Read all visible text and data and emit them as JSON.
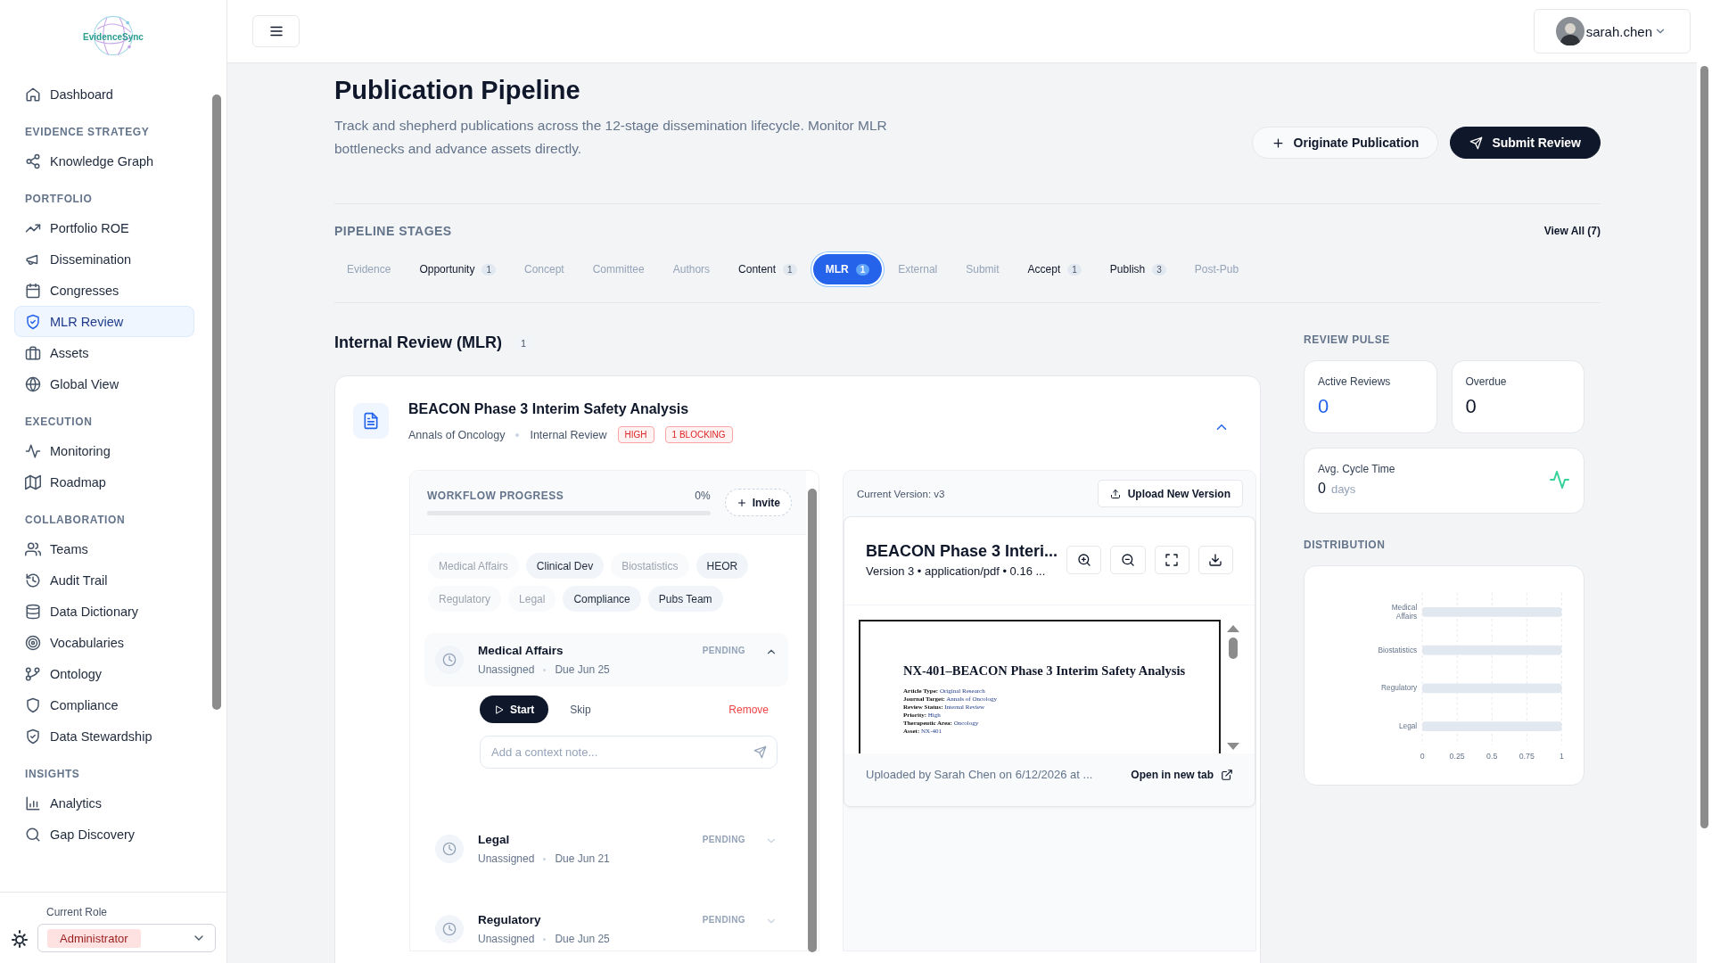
{
  "sidebar": {
    "logo_text": "EvidenceSync",
    "sections": [
      {
        "items": [
          {
            "label": "Dashboard",
            "selected": false
          }
        ]
      },
      {
        "title": "EVIDENCE STRATEGY",
        "items": [
          {
            "label": "Knowledge Graph",
            "selected": false
          }
        ]
      },
      {
        "title": "PORTFOLIO",
        "items": [
          {
            "label": "Portfolio ROE",
            "selected": false
          },
          {
            "label": "Dissemination",
            "selected": false
          },
          {
            "label": "Congresses",
            "selected": false
          },
          {
            "label": "MLR Review",
            "selected": true
          },
          {
            "label": "Assets",
            "selected": false
          },
          {
            "label": "Global View",
            "selected": false
          }
        ]
      },
      {
        "title": "EXECUTION",
        "items": [
          {
            "label": "Monitoring",
            "selected": false
          },
          {
            "label": "Roadmap",
            "selected": false
          }
        ]
      },
      {
        "title": "COLLABORATION",
        "items": [
          {
            "label": "Teams",
            "selected": false
          },
          {
            "label": "Audit Trail",
            "selected": false
          },
          {
            "label": "Data Dictionary",
            "selected": false
          },
          {
            "label": "Vocabularies",
            "selected": false
          },
          {
            "label": "Ontology",
            "selected": false
          },
          {
            "label": "Compliance",
            "selected": false
          },
          {
            "label": "Data Stewardship",
            "selected": false
          }
        ]
      },
      {
        "title": "INSIGHTS",
        "items": [
          {
            "label": "Analytics",
            "selected": false
          },
          {
            "label": "Gap Discovery",
            "selected": false
          }
        ]
      }
    ],
    "role_label": "Current Role",
    "role": "Administrator"
  },
  "header": {
    "user": "sarah.chen"
  },
  "page": {
    "title": "Publication Pipeline",
    "description": "Track and shepherd publications across the 12-stage dissemination lifecycle. Monitor MLR bottlenecks and advance assets directly.",
    "actions": [
      {
        "label": "Originate Publication",
        "kind": "secondary"
      },
      {
        "label": "Submit Review",
        "kind": "primary"
      }
    ]
  },
  "pipeline": {
    "title": "PIPELINE STAGES",
    "view_all": "View All (7)",
    "stages": [
      {
        "label": "Evidence",
        "selected": false
      },
      {
        "label": "Opportunity",
        "count": "1",
        "selected": false
      },
      {
        "label": "Concept",
        "selected": false
      },
      {
        "label": "Committee",
        "selected": false
      },
      {
        "label": "Authors",
        "selected": false
      },
      {
        "label": "Content",
        "count": "1",
        "selected": false
      },
      {
        "label": "MLR",
        "count": "1",
        "selected": true
      },
      {
        "label": "External",
        "selected": false
      },
      {
        "label": "Submit",
        "selected": false
      },
      {
        "label": "Accept",
        "count": "1",
        "selected": false
      },
      {
        "label": "Publish",
        "count": "3",
        "selected": false
      },
      {
        "label": "Post-Pub",
        "selected": false
      }
    ]
  },
  "review": {
    "title": "Internal Review (MLR)",
    "count": "1",
    "card": {
      "title": "BEACON Phase 3 Interim Safety Analysis",
      "journal": "Annals of Oncology",
      "status": "Internal Review",
      "badges": [
        "HIGH",
        "1 BLOCKING"
      ],
      "expanded": true,
      "workflow": {
        "label": "WORKFLOW PROGRESS",
        "percent": "0%",
        "level": 0,
        "invite": "Invite",
        "teams": [
          {
            "label": "Medical Affairs",
            "active": false
          },
          {
            "label": "Clinical Dev",
            "active": true
          },
          {
            "label": "Biostatistics",
            "active": false
          },
          {
            "label": "HEOR",
            "active": true
          },
          {
            "label": "Regulatory",
            "active": false
          },
          {
            "label": "Legal",
            "active": false
          },
          {
            "label": "Compliance",
            "active": true
          },
          {
            "label": "Pubs Team",
            "active": true
          }
        ],
        "steps": [
          {
            "name": "Medical Affairs",
            "assignee": "Unassigned",
            "due": "Due Jun 25",
            "status": "PENDING",
            "expanded": true,
            "actions": {
              "start": "Start",
              "skip": "Skip",
              "remove": "Remove"
            },
            "note_placeholder": "Add a context note..."
          },
          {
            "name": "Legal",
            "assignee": "Unassigned",
            "due": "Due Jun 21",
            "status": "PENDING",
            "expanded": false
          },
          {
            "name": "Regulatory",
            "assignee": "Unassigned",
            "due": "Due Jun 25",
            "status": "PENDING",
            "expanded": false
          }
        ]
      },
      "viewer": {
        "version": "Current Version: v3",
        "upload": "Upload New Version",
        "doc_title": "BEACON Phase 3 Interi...",
        "doc_meta": "Version 3 • application/pdf • 0.16 ...",
        "document": {
          "heading": "NX-401–BEACON Phase 3 Interim Safety Analysis",
          "fields": [
            {
              "label": "Article Type:",
              "value": "Original Research"
            },
            {
              "label": "Journal Target:",
              "value": "Annals of Oncology"
            },
            {
              "label": "Review Status:",
              "value": "Internal Review"
            },
            {
              "label": "Priority:",
              "value": "High"
            },
            {
              "label": "Therapeutic Area:",
              "value": "Oncology"
            },
            {
              "label": "Asset:",
              "value": "NX-401"
            }
          ]
        },
        "uploaded": "Uploaded by Sarah Chen on 6/12/2026 at ...",
        "open_link": "Open in new tab"
      }
    }
  },
  "pulse": {
    "title": "REVIEW PULSE",
    "stats": [
      {
        "label": "Active Reviews",
        "value": "0",
        "kind": "accent"
      },
      {
        "label": "Overdue",
        "value": "0",
        "kind": "plain"
      }
    ],
    "cycle": {
      "label": "Avg. Cycle Time",
      "value": "0",
      "unit": "days"
    }
  },
  "distribution": {
    "title": "DISTRIBUTION",
    "chart_data": {
      "type": "bar",
      "orientation": "horizontal",
      "categories": [
        "Medical Affairs",
        "Biostatistics",
        "Regulatory",
        "Legal"
      ],
      "series": [
        {
          "color": "#3b82f6",
          "values": [
            0,
            0,
            0,
            0
          ]
        },
        {
          "color": "#e2e8f0",
          "values": [
            1,
            1,
            1,
            1
          ]
        }
      ],
      "xlim": [
        0,
        1
      ],
      "xticks": [
        0,
        0.25,
        0.5,
        0.75,
        1
      ],
      "grid": true
    }
  }
}
